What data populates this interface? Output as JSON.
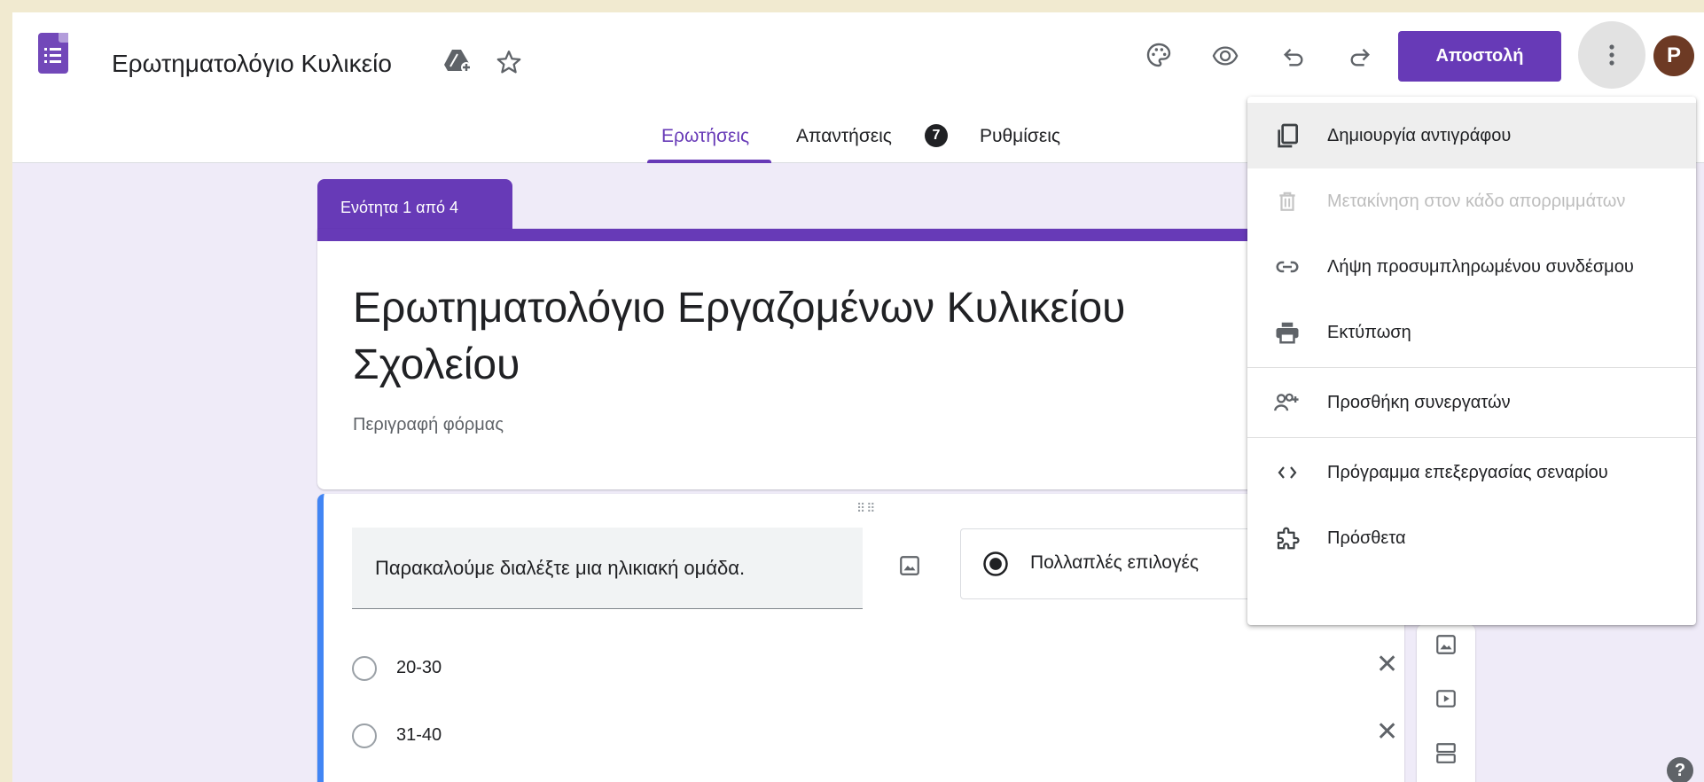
{
  "header": {
    "doc_title": "Ερωτηματολόγιο Κυλικείο",
    "send_label": "Αποστολή",
    "avatar_letter": "P",
    "icons": [
      "drive-move-icon",
      "star-icon",
      "palette-icon",
      "preview-eye-icon",
      "undo-icon",
      "redo-icon",
      "more-vert-icon"
    ]
  },
  "tabs": [
    {
      "label": "Ερωτήσεις",
      "active": true
    },
    {
      "label": "Απαντήσεις",
      "badge": "7"
    },
    {
      "label": "Ρυθμίσεις"
    }
  ],
  "section": {
    "label": "Ενότητα 1 από 4",
    "form_title": "Ερωτηματολόγιο Εργαζομένων Κυλικείου Σχολείου",
    "form_description": "Περιγραφή φόρμας"
  },
  "question": {
    "text": "Παρακαλούμε διαλέξτε μια ηλικιακή ομάδα.",
    "type": "Πολλαπλές επιλογές",
    "options": [
      "20-30",
      "31-40"
    ]
  },
  "menu": {
    "items": [
      {
        "label": "Δημιουργία αντιγράφου",
        "icon": "copy-icon",
        "state": "hover"
      },
      {
        "label": "Μετακίνηση στον κάδο απορριμμάτων",
        "icon": "trash-icon",
        "state": "disabled"
      },
      {
        "label": "Λήψη προσυμπληρωμένου συνδέσμου",
        "icon": "link-icon"
      },
      {
        "label": "Εκτύπωση",
        "icon": "print-icon"
      },
      {
        "label": "Προσθήκη συνεργατών",
        "icon": "add-people-icon"
      },
      {
        "label": "Πρόγραμμα επεξεργασίας σεναρίου",
        "icon": "code-icon"
      },
      {
        "label": "Πρόσθετα",
        "icon": "puzzle-icon"
      }
    ]
  },
  "colors": {
    "accent": "#673ab7",
    "background": "#efebf8",
    "question_highlight": "#4285f4",
    "outer_frame": "#f1ead0"
  }
}
